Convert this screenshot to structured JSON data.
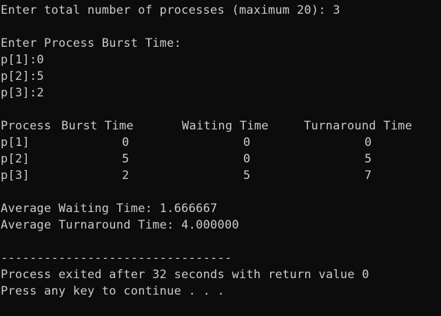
{
  "console": {
    "prompt_count": "Enter total number of processes (maximum 20): 3",
    "prompt_burst": "Enter Process Burst Time:",
    "inputs": [
      "p[1]:0",
      "p[2]:5",
      "p[3]:2"
    ],
    "table": {
      "headers": [
        "Process",
        "Burst Time",
        "Waiting Time",
        "Turnaround Time"
      ],
      "rows": [
        [
          "p[1]",
          "0",
          "0",
          "0"
        ],
        [
          "p[2]",
          "5",
          "0",
          "5"
        ],
        [
          "p[3]",
          "2",
          "5",
          "7"
        ]
      ]
    },
    "avg_waiting": "Average Waiting Time: 1.666667",
    "avg_turnaround": "Average Turnaround Time: 4.000000",
    "separator": "--------------------------------",
    "exit_message": "Process exited after 32 seconds with return value 0",
    "continue_message": "Press any key to continue . . ."
  },
  "colors": {
    "background": "#0c0c0c",
    "text": "#cccccc"
  }
}
